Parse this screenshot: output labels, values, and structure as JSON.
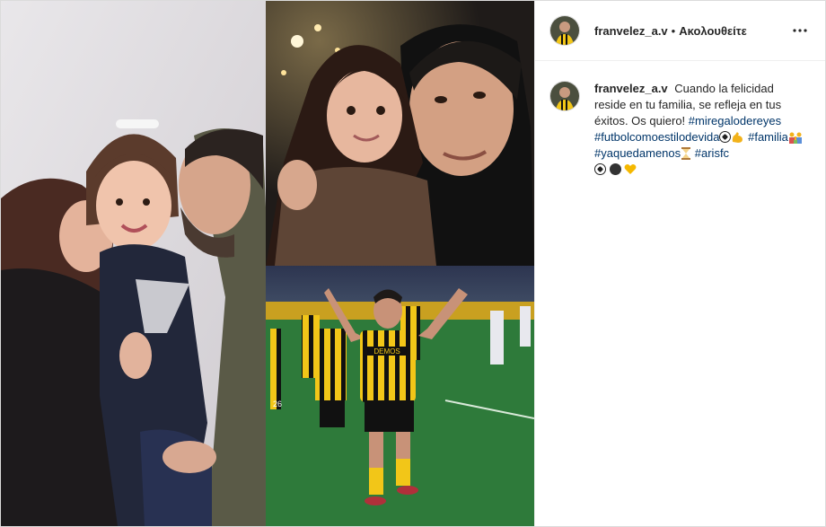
{
  "post": {
    "author": {
      "username": "franvelez_a.v",
      "avatar_icon": "profile-avatar"
    },
    "header": {
      "separator": "•",
      "follow_state": "Ακολουθείτε",
      "more_icon": "more-options-icon"
    },
    "caption": {
      "username": "franvelez_a.v",
      "text_1": "Cuando la felicidad reside en tu familia, se refleja en tus éxitos. Os quiero!",
      "hashtag_1": "#miregalodereyes",
      "hashtag_2": "#futbolcomoestilodevida",
      "hashtag_3": "#familia",
      "hashtag_4": "#yaquedamenos",
      "hashtag_5": "#arisfc"
    },
    "media": {
      "photos": [
        {
          "name": "family-kiss-photo"
        },
        {
          "name": "selfie-with-daughter-photo"
        },
        {
          "name": "goal-celebration-photo"
        }
      ],
      "jersey_sponsor": "DEMOS",
      "jersey_number": "26"
    },
    "colors": {
      "hashtag": "#003569",
      "border": "#dbdbdb",
      "aris_yellow": "#f2c618"
    }
  }
}
